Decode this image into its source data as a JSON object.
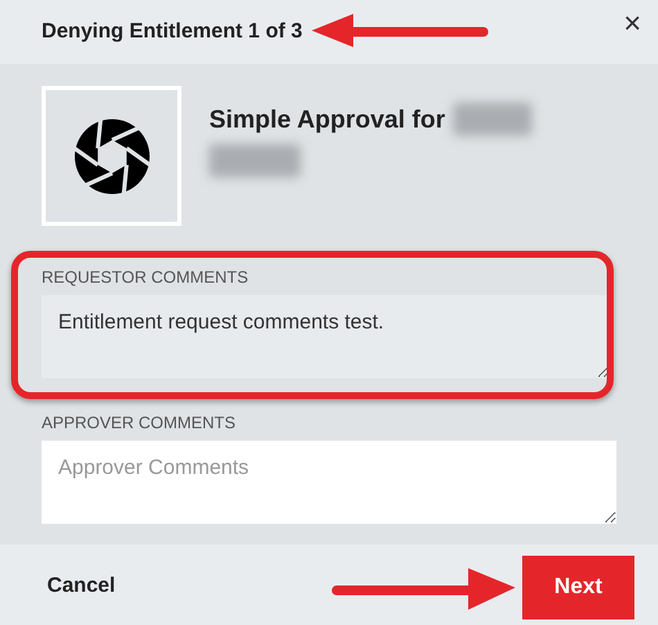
{
  "dialog": {
    "title": "Denying Entitlement 1 of 3",
    "close": "×"
  },
  "item": {
    "name": "Simple Approval for"
  },
  "fields": [
    {
      "label": "REQUESTOR COMMENTS",
      "value": "Entitlement request comments test.",
      "highlighted": true
    },
    {
      "label": "APPROVER COMMENTS",
      "placeholder": "Approver Comments",
      "highlighted": false
    }
  ],
  "footer": {
    "cancel": "Cancel",
    "next": "Next"
  }
}
